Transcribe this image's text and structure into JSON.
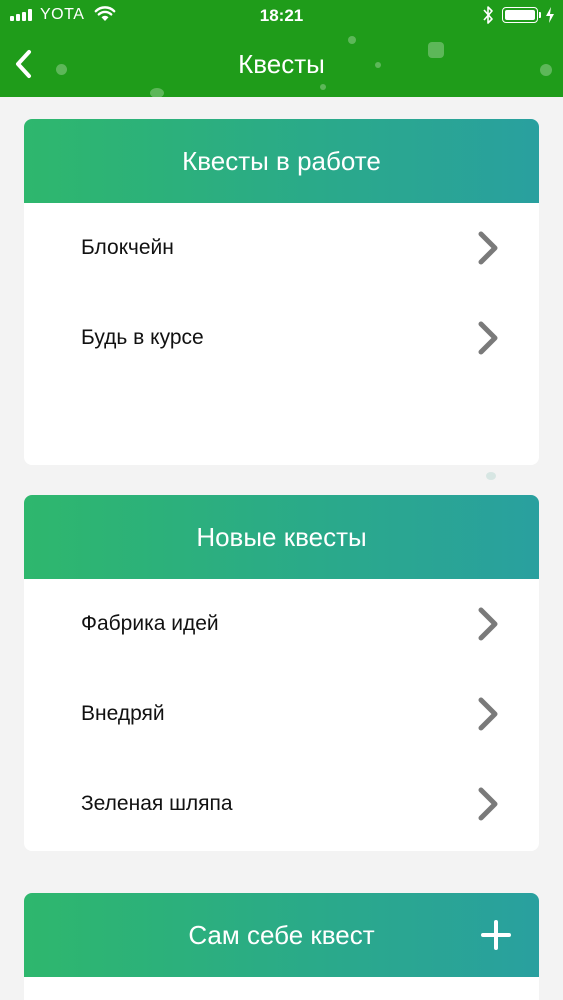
{
  "status_bar": {
    "carrier": "YOTA",
    "time": "18:21"
  },
  "nav": {
    "title": "Квесты"
  },
  "sections": [
    {
      "title": "Квесты в работе",
      "items": [
        {
          "label": "Блокчейн"
        },
        {
          "label": "Будь в курсе"
        }
      ]
    },
    {
      "title": "Новые квесты",
      "items": [
        {
          "label": "Фабрика идей"
        },
        {
          "label": "Внедряй"
        },
        {
          "label": "Зеленая шляпа"
        }
      ]
    },
    {
      "title": "Сам себе квест"
    }
  ],
  "colors": {
    "header_green": "#1f9c1a",
    "card_gradient_start": "#2eb76d",
    "card_gradient_end": "#29a09f",
    "chevron_gray": "#7a7a7a"
  },
  "icons": {
    "back": "chevron-left-icon",
    "row": "chevron-right-icon",
    "add": "plus-icon"
  }
}
